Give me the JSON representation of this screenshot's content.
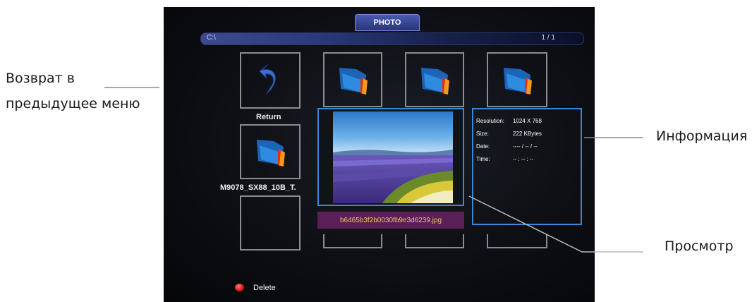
{
  "callouts": {
    "back": {
      "line1": "Возврат в",
      "line2": "предыдущее меню"
    },
    "info": "Информация",
    "preview": "Просмотр"
  },
  "screen": {
    "title": "PHOTO",
    "path": "C:\\",
    "page": "1 / 1",
    "tiles": {
      "return_label": "Return",
      "folder_label": "M9078_SX88_10B_T."
    },
    "preview_filename": "b6465b3f2b0030fb9e3d6239.jpg",
    "info": {
      "resolution_key": "Resolution:",
      "resolution_val": "1024 X 768",
      "size_key": "Size:",
      "size_val": "222 KBytes",
      "date_key": "Date:",
      "date_val": "---- / -- / --",
      "time_key": "Time:",
      "time_val": "-- : -- : --"
    },
    "delete_label": "Delete"
  },
  "colors": {
    "accent_border": "#3c86d8",
    "title_tab": "#3a4a9a",
    "filename_bar": "#5a1f57",
    "delete_button": "#d81414"
  },
  "icons": [
    "return-arrow-icon",
    "folder-icon",
    "red-dot-icon"
  ]
}
